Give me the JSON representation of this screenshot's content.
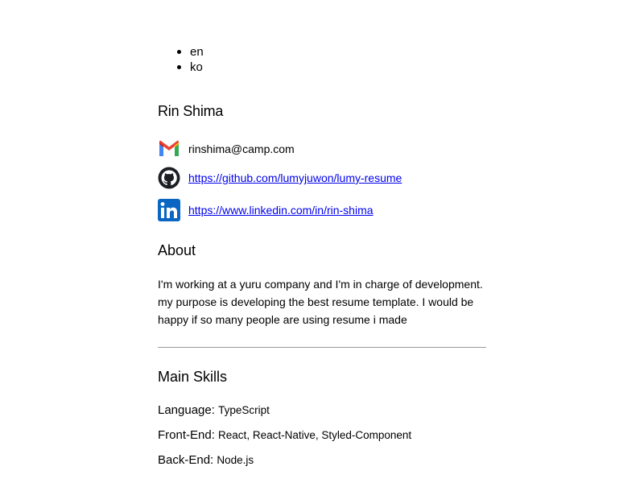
{
  "languages": [
    "en",
    "ko"
  ],
  "profile": {
    "name": "Rin Shima",
    "email": "rinshima@camp.com",
    "github_url": "https://github.com/lumyjuwon/lumy-resume",
    "linkedin_url": "https://www.linkedin.com/in/rin-shima"
  },
  "icons": {
    "email": "gmail-icon",
    "github": "github-icon",
    "linkedin": "linkedin-icon"
  },
  "colors": {
    "link": "#0000ee",
    "gmail_red": "#ea4335",
    "gmail_blue": "#4285f4",
    "gmail_green": "#34a853",
    "gmail_yellow": "#fbbc04",
    "linkedin_blue": "#0a66c2"
  },
  "about": {
    "title": "About",
    "text": "I'm working at a yuru company and I'm in charge of development. my purpose is developing the best resume template. I would be happy if so many people are using resume i made"
  },
  "skills": {
    "title": "Main Skills",
    "items": [
      {
        "label": "Language:",
        "value": "TypeScript"
      },
      {
        "label": "Front-End:",
        "value": "React, React-Native, Styled-Component"
      },
      {
        "label": "Back-End:",
        "value": "Node.js"
      }
    ]
  }
}
